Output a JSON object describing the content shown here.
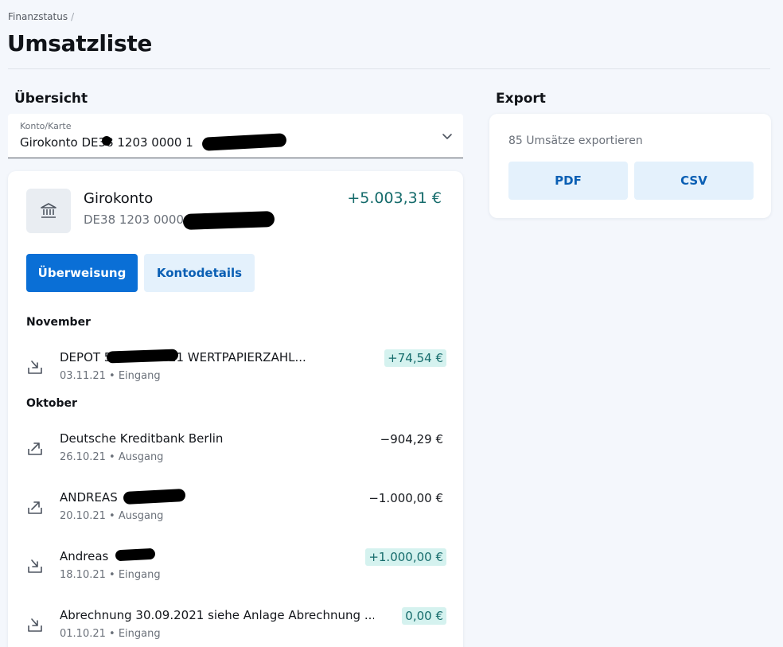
{
  "breadcrumb": {
    "item": "Finanzstatus",
    "separator": "/"
  },
  "page_title": "Umsatzliste",
  "overview": {
    "title": "Übersicht",
    "select_label": "Konto/Karte",
    "select_value": "Girokonto DE38 1203 0000 1"
  },
  "account": {
    "name": "Girokonto",
    "iban": "DE38 1203 0000",
    "balance": "+5.003,31 €",
    "transfer_button": "Überweisung",
    "details_button": "Kontodetails"
  },
  "months": {
    "november": "November",
    "oktober": "Oktober"
  },
  "transactions": [
    {
      "title": "DEPOT 5              03.11.2021 WERTPAPIERZAHL...",
      "meta": "03.11.21 • Eingang",
      "amount": "+74,54 €"
    },
    {
      "title": "Deutsche Kreditbank Berlin",
      "meta": "26.10.21 • Ausgang",
      "amount": "−904,29 €"
    },
    {
      "title": "ANDREAS",
      "meta": "20.10.21 • Ausgang",
      "amount": "−1.000,00 €"
    },
    {
      "title": "Andreas",
      "meta": "18.10.21 • Eingang",
      "amount": "+1.000,00 €"
    },
    {
      "title": "Abrechnung 30.09.2021 siehe Anlage Abrechnung ...",
      "meta": "01.10.21 • Eingang",
      "amount": "0,00 €"
    }
  ],
  "export": {
    "title": "Export",
    "description": "85 Umsätze exportieren",
    "pdf_label": "PDF",
    "csv_label": "CSV"
  },
  "colors": {
    "primary": "#0a6fd6",
    "positive": "#156b6b",
    "positive_bg": "#d5f2ef",
    "secondary_bg": "#e4f1fc"
  }
}
